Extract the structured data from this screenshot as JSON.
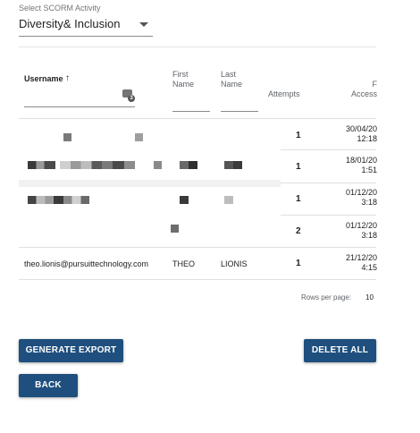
{
  "activity_select": {
    "label": "Select SCORM Activity",
    "value": "Diversity& Inclusion",
    "arrow_icon": "arrow-drop-down-icon"
  },
  "table": {
    "headers": {
      "username": "Username",
      "first_name_1": "First",
      "first_name_2": "Name",
      "last_name_1": "Last",
      "last_name_2": "Name",
      "attempts": "Attempts",
      "first_access_1": "F",
      "first_access_2": "Access"
    },
    "sort_icon": "arrow-up-icon",
    "filter_icon": "filter-list-icon",
    "filter_badge": "3",
    "rows": [
      {
        "username": "",
        "first_name": "",
        "last_name": "",
        "attempts": "1",
        "date": "30/04/20",
        "time": "12:18"
      },
      {
        "username": "",
        "first_name": "",
        "last_name": "",
        "attempts": "1",
        "date": "18/01/20",
        "time": "1:51"
      },
      {
        "username": "",
        "first_name": "",
        "last_name": "",
        "attempts": "1",
        "date": "01/12/20",
        "time": "3:18"
      },
      {
        "username": "",
        "first_name": "",
        "last_name": "",
        "attempts": "2",
        "date": "01/12/20",
        "time": "3:18"
      },
      {
        "username": "theo.lionis@pursuittechnology.com",
        "first_name": "THEO",
        "last_name": "LIONIS",
        "attempts": "1",
        "date": "21/12/20",
        "time": "4:15"
      }
    ]
  },
  "pagination": {
    "rows_per_page_label": "Rows per page:",
    "rows_per_page_value": "10"
  },
  "buttons": {
    "generate_export": "GENERATE EXPORT",
    "delete_all": "DELETE ALL",
    "back": "BACK"
  }
}
